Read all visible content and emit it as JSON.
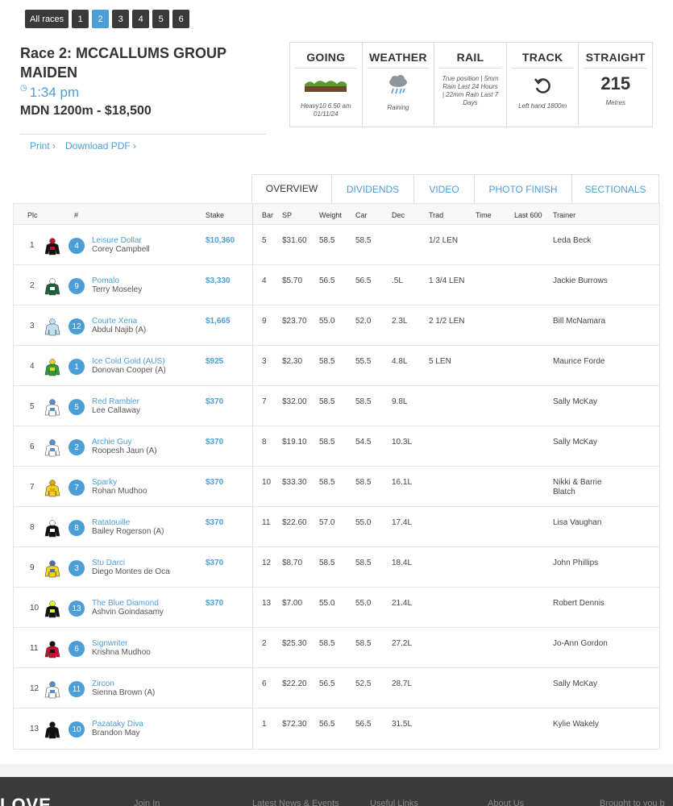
{
  "race_nav": {
    "all": "All races",
    "numbers": [
      "1",
      "2",
      "3",
      "4",
      "5",
      "6"
    ],
    "active": "2"
  },
  "race": {
    "title": "Race 2: MCCALLUMS GROUP MAIDEN",
    "time": "1:34 pm",
    "class": "MDN 1200m - $18,500",
    "print": "Print ›",
    "pdf": "Download PDF ›"
  },
  "conditions": {
    "going": {
      "label": "GOING",
      "value": "Heavy10 6.50 am 01/11/24"
    },
    "weather": {
      "label": "WEATHER",
      "value": "Raining"
    },
    "rail": {
      "label": "RAIL",
      "value": "True position | 5mm Rain Last 24 Hours | 22mm Rain Last 7 Days"
    },
    "track": {
      "label": "TRACK",
      "value": "Left hand 1800m"
    },
    "straight": {
      "label": "STRAIGHT",
      "value": "215",
      "unit": "Metres"
    }
  },
  "tabs": [
    "OVERVIEW",
    "DIVIDENDS",
    "VIDEO",
    "PHOTO FINISH",
    "SECTIONALS"
  ],
  "columns": {
    "plc": "Plc",
    "num": "#",
    "stake": "Stake",
    "bar": "Bar",
    "sp": "SP",
    "weight": "Weight",
    "car": "Car",
    "dec": "Dec",
    "trad": "Trad",
    "time": "Time",
    "last600": "Last 600",
    "trainer": "Trainer"
  },
  "rows": [
    {
      "plc": "1",
      "num": "4",
      "horse": "Leisure Dollar",
      "jockey": "Corey Campbell",
      "stake": "$10,360",
      "bar": "5",
      "sp": "$31.60",
      "weight": "58.5",
      "car": "58.5",
      "dec": "",
      "trad": "1/2 LEN",
      "trainer": "Leda Beck"
    },
    {
      "plc": "2",
      "num": "9",
      "horse": "Pomalo",
      "jockey": "Terry Moseley",
      "stake": "$3,330",
      "bar": "4",
      "sp": "$5.70",
      "weight": "56.5",
      "car": "56.5",
      "dec": ".5L",
      "trad": "1 3/4 LEN",
      "trainer": "Jackie Burrows"
    },
    {
      "plc": "3",
      "num": "12",
      "horse": "Courte Xena",
      "jockey": "Abdul Najib (A)",
      "stake": "$1,665",
      "bar": "9",
      "sp": "$23.70",
      "weight": "55.0",
      "car": "52.0",
      "dec": "2.3L",
      "trad": "2 1/2 LEN",
      "trainer": "Bill McNamara"
    },
    {
      "plc": "4",
      "num": "1",
      "horse": "Ice Cold Gold (AUS)",
      "jockey": "Donovan Cooper (A)",
      "stake": "$925",
      "bar": "3",
      "sp": "$2.30",
      "weight": "58.5",
      "car": "55.5",
      "dec": "4.8L",
      "trad": "5 LEN",
      "trainer": "Maurice Forde"
    },
    {
      "plc": "5",
      "num": "5",
      "horse": "Red Rambler",
      "jockey": "Lee Callaway",
      "stake": "$370",
      "bar": "7",
      "sp": "$32.00",
      "weight": "58.5",
      "car": "58.5",
      "dec": "9.8L",
      "trad": "",
      "trainer": "Sally McKay"
    },
    {
      "plc": "6",
      "num": "2",
      "horse": "Archie Guy",
      "jockey": "Roopesh Jaun (A)",
      "stake": "$370",
      "bar": "8",
      "sp": "$19.10",
      "weight": "58.5",
      "car": "54.5",
      "dec": "10.3L",
      "trad": "",
      "trainer": "Sally McKay"
    },
    {
      "plc": "7",
      "num": "7",
      "horse": "Sparky",
      "jockey": "Rohan Mudhoo",
      "stake": "$370",
      "bar": "10",
      "sp": "$33.30",
      "weight": "58.5",
      "car": "58.5",
      "dec": "16.1L",
      "trad": "",
      "trainer": "Nikki & Barrie Blatch"
    },
    {
      "plc": "8",
      "num": "8",
      "horse": "Ratatouille",
      "jockey": "Bailey Rogerson (A)",
      "stake": "$370",
      "bar": "11",
      "sp": "$22.60",
      "weight": "57.0",
      "car": "55.0",
      "dec": "17.4L",
      "trad": "",
      "trainer": "Lisa Vaughan"
    },
    {
      "plc": "9",
      "num": "3",
      "horse": "Stu Darci",
      "jockey": "Diego Montes de Oca",
      "stake": "$370",
      "bar": "12",
      "sp": "$8.70",
      "weight": "58.5",
      "car": "58.5",
      "dec": "18.4L",
      "trad": "",
      "trainer": "John Phillips"
    },
    {
      "plc": "10",
      "num": "13",
      "horse": "The Blue Diamond",
      "jockey": "Ashvin Goindasamy",
      "stake": "$370",
      "bar": "13",
      "sp": "$7.00",
      "weight": "55.0",
      "car": "55.0",
      "dec": "21.4L",
      "trad": "",
      "trainer": "Robert Dennis"
    },
    {
      "plc": "11",
      "num": "6",
      "horse": "Signwriter",
      "jockey": "Krishna Mudhoo",
      "stake": "",
      "bar": "2",
      "sp": "$25.30",
      "weight": "58.5",
      "car": "58.5",
      "dec": "27.2L",
      "trad": "",
      "trainer": "Jo-Ann Gordon"
    },
    {
      "plc": "12",
      "num": "11",
      "horse": "Zircon",
      "jockey": "Sienna Brown (A)",
      "stake": "",
      "bar": "6",
      "sp": "$22.20",
      "weight": "56.5",
      "car": "52.5",
      "dec": "28.7L",
      "trad": "",
      "trainer": "Sally McKay"
    },
    {
      "plc": "13",
      "num": "10",
      "horse": "Pazataky Diva",
      "jockey": "Brandon May",
      "stake": "",
      "bar": "1",
      "sp": "$72.30",
      "weight": "56.5",
      "car": "56.5",
      "dec": "31.5L",
      "trad": "",
      "trainer": "Kylie Wakely"
    }
  ],
  "silk_colors": [
    [
      "#111111",
      "#c8102e"
    ],
    [
      "#1f5f3a",
      "#ffffff"
    ],
    [
      "#bfe1f2",
      "#bfe1f2"
    ],
    [
      "#2a9d3a",
      "#f2d21b"
    ],
    [
      "#ffffff",
      "#5b8fc9"
    ],
    [
      "#ffffff",
      "#5b8fc9"
    ],
    [
      "#f2d21b",
      "#e9a400"
    ],
    [
      "#111111",
      "#ffffff"
    ],
    [
      "#f2d21b",
      "#4b6cb7"
    ],
    [
      "#111111",
      "#e4ff1a"
    ],
    [
      "#c8102e",
      "#111111"
    ],
    [
      "#ffffff",
      "#5b8fc9"
    ],
    [
      "#111111",
      "#111111"
    ]
  ],
  "footer": {
    "logo": "LOVE",
    "links": [
      "Join In",
      "Latest News & Events",
      "Useful Links",
      "About Us",
      "Brought to you b"
    ]
  },
  "accent_color": "#4b9ed6"
}
